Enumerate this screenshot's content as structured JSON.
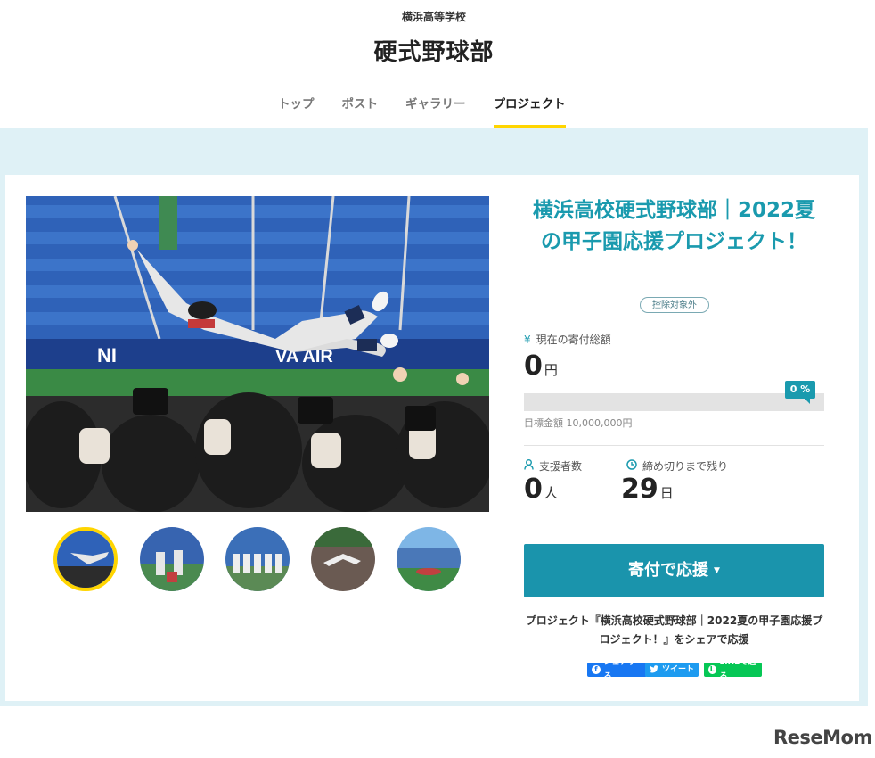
{
  "header": {
    "school": "横浜高等学校",
    "club": "硬式野球部"
  },
  "nav": {
    "items": [
      "トップ",
      "ポスト",
      "ギャラリー",
      "プロジェクト"
    ],
    "active": "プロジェクト"
  },
  "project": {
    "title": "横浜高校硬式野球部｜2022夏の甲子園応援プロジェクト！",
    "badge": "控除対象外",
    "donation_label": "現在の寄付総額",
    "donation_amount": "0",
    "donation_unit": "円",
    "progress_percent": 0,
    "progress_label": "0 %",
    "goal": "目標金額 10,000,000円",
    "supporters_label": "支援者数",
    "supporters_value": "0",
    "supporters_unit": "人",
    "deadline_label": "締め切りまで残り",
    "deadline_value": "29",
    "deadline_unit": "日",
    "donate_button": "寄付で応援",
    "share_text": "プロジェクト『横浜高校硬式野球部｜2022夏の甲子園応援プロジェクト！』をシェアで応援"
  },
  "share_buttons": {
    "facebook": "シェアする",
    "twitter": "ツイート",
    "line": "LINEで送る"
  },
  "icons": {
    "donation": "yen-icon",
    "supporters": "person-icon",
    "deadline": "clock-icon",
    "donate_caret": "caret-down-icon"
  },
  "colors": {
    "accent": "#1a9aae",
    "nav_active": "#ffd500",
    "band": "#dff1f6",
    "button": "#1a94ac"
  },
  "watermark": "ReseMom"
}
